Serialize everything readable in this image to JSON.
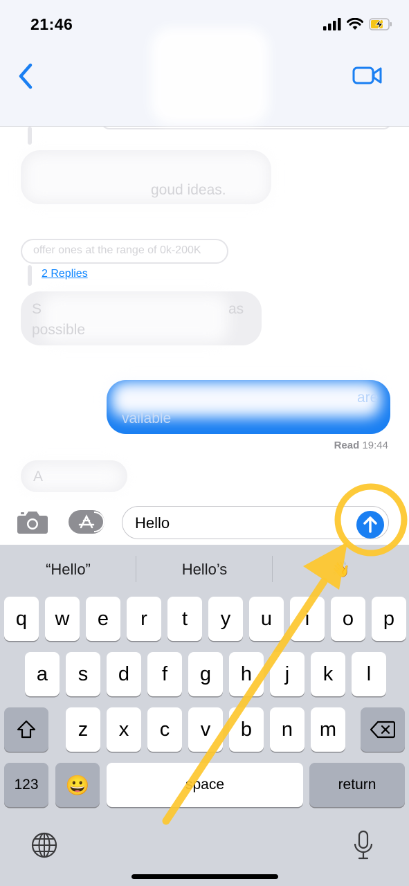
{
  "status_bar": {
    "time": "21:46"
  },
  "chat": {
    "faint_texts": [
      "goud ideas.",
      "offer ones at the range of 0k-200K",
      "S",
      "as",
      "possible",
      "are",
      "vailable",
      "A"
    ],
    "replies_link": "2 Replies",
    "read_label": "Read",
    "read_time": "19:44"
  },
  "input": {
    "value": "Hello"
  },
  "keyboard": {
    "suggestions": [
      "“Hello”",
      "Hello’s",
      "👋"
    ],
    "row1": [
      "q",
      "w",
      "e",
      "r",
      "t",
      "y",
      "u",
      "i",
      "o",
      "p"
    ],
    "row2": [
      "a",
      "s",
      "d",
      "f",
      "g",
      "h",
      "j",
      "k",
      "l"
    ],
    "row3": [
      "z",
      "x",
      "c",
      "v",
      "b",
      "n",
      "m"
    ],
    "numbers_label": "123",
    "emoji": "😀",
    "space_label": "space",
    "return_label": "return"
  },
  "icons": {
    "back": "chevron-left-icon",
    "video": "video-camera-icon",
    "camera": "camera-icon",
    "apps": "app-store-icon",
    "send": "arrow-up-icon",
    "shift": "shift-icon",
    "delete": "delete-icon",
    "globe": "globe-icon",
    "mic": "microphone-icon"
  },
  "colors": {
    "accent": "#1a7ff2",
    "annotation": "#fdc72f",
    "keyboard_bg": "#d2d5dc"
  }
}
